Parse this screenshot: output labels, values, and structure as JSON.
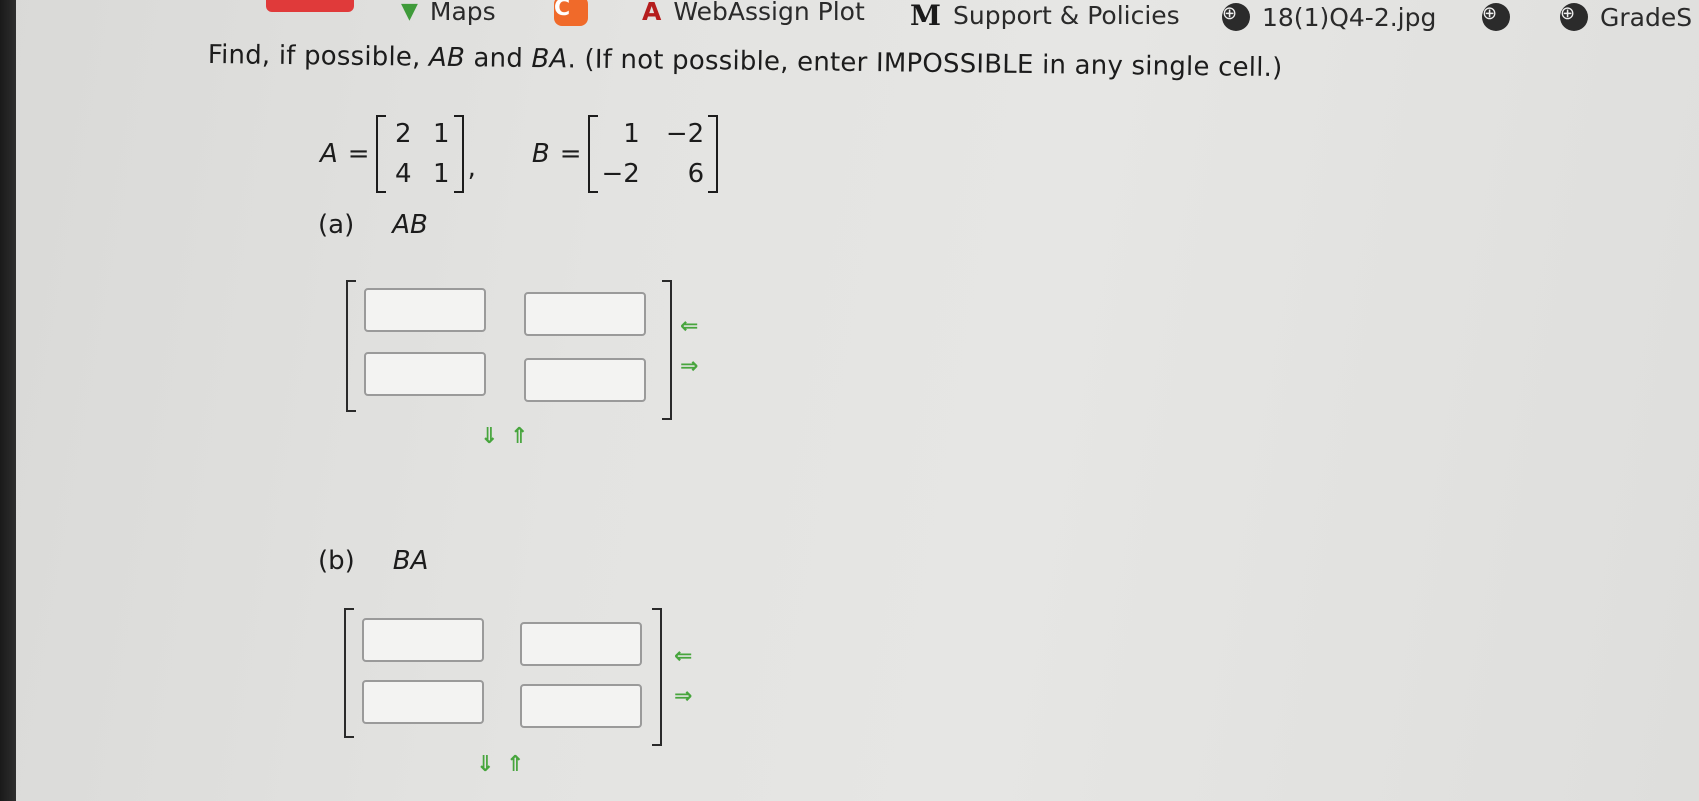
{
  "bookmarks": [
    {
      "label": "Maps",
      "icon": "maps-pin-icon"
    },
    {
      "label": "",
      "icon": "orange-c-icon"
    },
    {
      "label": "WebAssign Plot",
      "icon": "webassign-icon"
    },
    {
      "label": "Support & Policies",
      "icon": "m-logo-icon"
    },
    {
      "label": "18(1)Q4-2.jpg",
      "icon": "globe-icon"
    },
    {
      "label": "",
      "icon": "globe-icon"
    },
    {
      "label": "GradeS",
      "icon": "globe-icon"
    }
  ],
  "question": {
    "prefix": "Find, if possible, ",
    "ab": "AB",
    "and": " and ",
    "ba": "BA",
    "suffix": ". (If not possible, enter IMPOSSIBLE in any single cell.)"
  },
  "matrix_a": {
    "label": "A",
    "eq": "=",
    "cells": [
      "2",
      "1",
      "4",
      "1"
    ],
    "sep": ","
  },
  "matrix_b": {
    "label": "B",
    "eq": "=",
    "cells": [
      "1",
      "−2",
      "−2",
      "6"
    ]
  },
  "part_a": {
    "letter": "(a)",
    "name": "AB",
    "cells": [
      "",
      "",
      "",
      ""
    ]
  },
  "part_b": {
    "letter": "(b)",
    "name": "BA",
    "cells": [
      "",
      "",
      "",
      ""
    ]
  },
  "controls": {
    "remove_col": "⇐",
    "add_col": "⇒",
    "add_row": "⇓",
    "remove_row": "⇑"
  },
  "colors": {
    "arrow": "#47a53d",
    "bezel": "#1a1a1a",
    "background": "#e3e3e1"
  }
}
